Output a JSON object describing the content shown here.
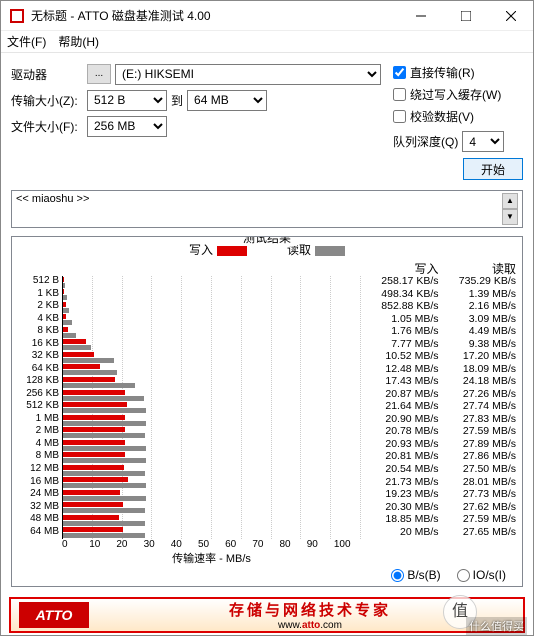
{
  "window": {
    "title": "无标题 - ATTO 磁盘基准测试 4.00"
  },
  "menu": {
    "file": "文件(F)",
    "help": "帮助(H)"
  },
  "form": {
    "drive_label": "驱动器",
    "browse": "...",
    "drive_value": "(E:) HIKSEMI",
    "xfer_label": "传输大小(Z):",
    "xfer_from": "512 B",
    "to": "到",
    "xfer_to": "64 MB",
    "file_label": "文件大小(F):",
    "file_size": "256 MB"
  },
  "opts": {
    "direct": "直接传输(R)",
    "bypass": "绕过写入缓存(W)",
    "verify": "校验数据(V)",
    "qd_label": "队列深度(Q)",
    "qd_value": "4",
    "start": "开始"
  },
  "desc": "<< miaoshu >>",
  "results_title": "测试结果",
  "legend": {
    "write": "写入",
    "read": "读取"
  },
  "xaxis_label": "传输速率 - MB/s",
  "radio": {
    "bs": "B/s(B)",
    "ios": "IO/s(I)"
  },
  "footer": {
    "logo": "ATTO",
    "cn": "存储与网络技术专家",
    "url_pre": "www.",
    "url_mid": "atto",
    "url_post": ".com"
  },
  "watermark": {
    "char": "值",
    "text": "什么值得买"
  },
  "chart_data": {
    "type": "bar",
    "xlabel": "传输速率 - MB/s",
    "xlim": [
      0,
      100
    ],
    "xticks": [
      0,
      10,
      20,
      30,
      40,
      50,
      60,
      70,
      80,
      90,
      100
    ],
    "series_names": [
      "写入",
      "读取"
    ],
    "rows": [
      {
        "label": "512 B",
        "write_txt": "258.17 KB/s",
        "read_txt": "735.29 KB/s",
        "w": 0.26,
        "r": 0.74
      },
      {
        "label": "1 KB",
        "write_txt": "498.34 KB/s",
        "read_txt": "1.39 MB/s",
        "w": 0.5,
        "r": 1.39
      },
      {
        "label": "2 KB",
        "write_txt": "852.88 KB/s",
        "read_txt": "2.16 MB/s",
        "w": 0.85,
        "r": 2.16
      },
      {
        "label": "4 KB",
        "write_txt": "1.05 MB/s",
        "read_txt": "3.09 MB/s",
        "w": 1.05,
        "r": 3.09
      },
      {
        "label": "8 KB",
        "write_txt": "1.76 MB/s",
        "read_txt": "4.49 MB/s",
        "w": 1.76,
        "r": 4.49
      },
      {
        "label": "16 KB",
        "write_txt": "7.77 MB/s",
        "read_txt": "9.38 MB/s",
        "w": 7.77,
        "r": 9.38
      },
      {
        "label": "32 KB",
        "write_txt": "10.52 MB/s",
        "read_txt": "17.20 MB/s",
        "w": 10.52,
        "r": 17.2
      },
      {
        "label": "64 KB",
        "write_txt": "12.48 MB/s",
        "read_txt": "18.09 MB/s",
        "w": 12.48,
        "r": 18.09
      },
      {
        "label": "128 KB",
        "write_txt": "17.43 MB/s",
        "read_txt": "24.18 MB/s",
        "w": 17.43,
        "r": 24.18
      },
      {
        "label": "256 KB",
        "write_txt": "20.87 MB/s",
        "read_txt": "27.26 MB/s",
        "w": 20.87,
        "r": 27.26
      },
      {
        "label": "512 KB",
        "write_txt": "21.64 MB/s",
        "read_txt": "27.74 MB/s",
        "w": 21.64,
        "r": 27.74
      },
      {
        "label": "1 MB",
        "write_txt": "20.90 MB/s",
        "read_txt": "27.83 MB/s",
        "w": 20.9,
        "r": 27.83
      },
      {
        "label": "2 MB",
        "write_txt": "20.78 MB/s",
        "read_txt": "27.59 MB/s",
        "w": 20.78,
        "r": 27.59
      },
      {
        "label": "4 MB",
        "write_txt": "20.93 MB/s",
        "read_txt": "27.89 MB/s",
        "w": 20.93,
        "r": 27.89
      },
      {
        "label": "8 MB",
        "write_txt": "20.81 MB/s",
        "read_txt": "27.86 MB/s",
        "w": 20.81,
        "r": 27.86
      },
      {
        "label": "12 MB",
        "write_txt": "20.54 MB/s",
        "read_txt": "27.50 MB/s",
        "w": 20.54,
        "r": 27.5
      },
      {
        "label": "16 MB",
        "write_txt": "21.73 MB/s",
        "read_txt": "28.01 MB/s",
        "w": 21.73,
        "r": 28.01
      },
      {
        "label": "24 MB",
        "write_txt": "19.23 MB/s",
        "read_txt": "27.73 MB/s",
        "w": 19.23,
        "r": 27.73
      },
      {
        "label": "32 MB",
        "write_txt": "20.30 MB/s",
        "read_txt": "27.62 MB/s",
        "w": 20.3,
        "r": 27.62
      },
      {
        "label": "48 MB",
        "write_txt": "18.85 MB/s",
        "read_txt": "27.59 MB/s",
        "w": 18.85,
        "r": 27.59
      },
      {
        "label": "64 MB",
        "write_txt": "20 MB/s",
        "read_txt": "27.65 MB/s",
        "w": 20.0,
        "r": 27.65
      }
    ]
  }
}
